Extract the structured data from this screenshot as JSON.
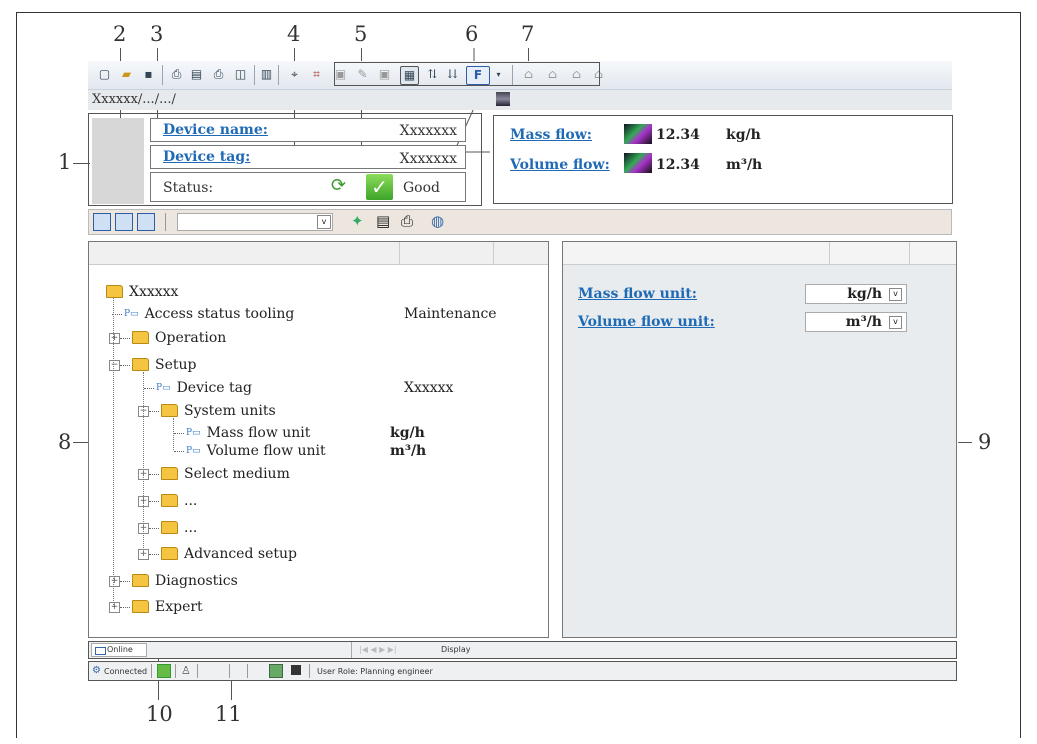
{
  "callouts": [
    "1",
    "2",
    "3",
    "4",
    "5",
    "6",
    "7",
    "8",
    "9",
    "10",
    "11"
  ],
  "toolbar": {
    "icons": [
      "new-icon",
      "open-icon",
      "save-icon",
      "print-icon",
      "print-preview-icon",
      "device-icon",
      "print2-icon",
      "preview-icon",
      "report-icon",
      "connect-icon",
      "disconnect-icon",
      "read-icon",
      "write-icon",
      "online-parameterize-icon",
      "online-icon",
      "upload-icon",
      "download-icon",
      "function-icon",
      "offline-icon",
      "offline2-icon",
      "offline3-icon",
      "offline4-icon"
    ],
    "function_label": "F"
  },
  "breadcrumb": "Xxxxxx/.../.../",
  "header": {
    "device_name_label": "Device name:",
    "device_name_value": "Xxxxxxx",
    "device_tag_label": "Device tag:",
    "device_tag_value": "Xxxxxxx",
    "status_label": "Status:",
    "status_value": "Good"
  },
  "measured": {
    "mass_flow_label": "Mass flow:",
    "mass_flow_value": "12.34",
    "mass_flow_unit": "kg/h",
    "volume_flow_label": "Volume flow:",
    "volume_flow_value": "12.34",
    "volume_flow_unit": "m³/h"
  },
  "tree": {
    "root": "Xxxxxx",
    "access_status": "Access status tooling",
    "access_status_value": "Maintenance",
    "operation": "Operation",
    "setup": "Setup",
    "device_tag": "Device tag",
    "device_tag_value": "Xxxxxx",
    "system_units": "System units",
    "mass_flow_unit": "Mass flow unit",
    "mass_flow_unit_value": "kg/h",
    "volume_flow_unit": "Volume flow unit",
    "volume_flow_unit_value": "m³/h",
    "select_medium": "Select medium",
    "ellipsis1": "...",
    "ellipsis2": "...",
    "advanced_setup": "Advanced setup",
    "diagnostics": "Diagnostics",
    "expert": "Expert"
  },
  "param_panel": {
    "mass_flow_unit_label": "Mass flow unit:",
    "mass_flow_unit_value": "kg/h",
    "volume_flow_unit_label": "Volume flow unit:",
    "volume_flow_unit_value": "m³/h"
  },
  "statusbar": {
    "tab_online": "Online",
    "display_label": "Display",
    "connected": "Connected",
    "user_role": "User Role: Planning engineer"
  }
}
